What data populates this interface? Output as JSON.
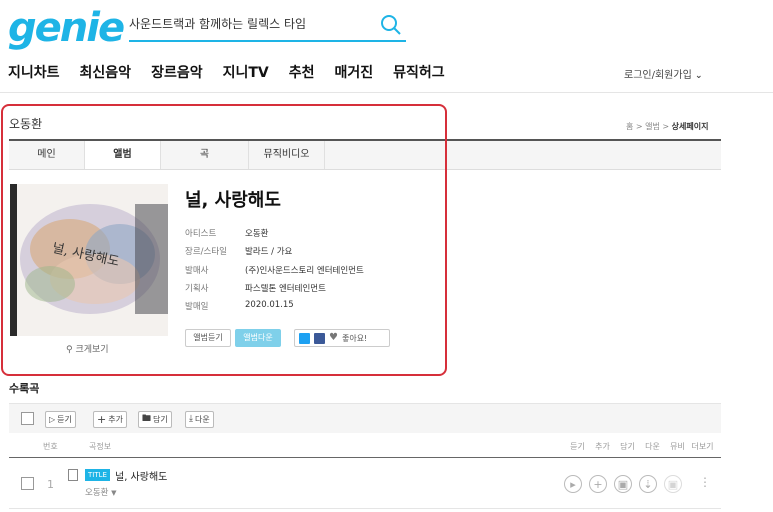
{
  "header": {
    "logo": "genie",
    "search_value": "사운드트랙과 함께하는 릴렉스 타임",
    "nav": [
      "지니차트",
      "최신음악",
      "장르음악",
      "지니TV",
      "추천",
      "매거진",
      "뮤직허그"
    ],
    "login": "로그인/회원가입"
  },
  "album": {
    "artist": "오동환",
    "breadcrumb_prefix": "홈 > 앨범 > ",
    "breadcrumb_current": "상세페이지",
    "tabs": [
      "메인",
      "앨범",
      "곡",
      "뮤직비디오"
    ],
    "title": "널, 사랑해도",
    "info": [
      {
        "label": "아티스트",
        "value": "오동환"
      },
      {
        "label": "장르/스타일",
        "value": "발라드 / 가요"
      },
      {
        "label": "발매사",
        "value": "(주)인사운드스토리 엔터테인먼트"
      },
      {
        "label": "기획사",
        "value": "파스텔톤 엔터테인먼트"
      },
      {
        "label": "발매일",
        "value": "2020.01.15"
      }
    ],
    "zoom_label": "크게보기",
    "btn_listen": "앨범듣기",
    "btn_download": "앨범다운",
    "like_label": "좋아요!",
    "cover_text": "널, 사랑해도"
  },
  "tracks": {
    "title": "수록곡",
    "toolbar": [
      "듣기",
      "추가",
      "담기",
      "다운"
    ],
    "columns": {
      "no": "번호",
      "info": "곡정보",
      "actions": [
        "듣기",
        "추가",
        "담기",
        "다운",
        "뮤비",
        "더보기"
      ]
    },
    "rows": [
      {
        "no": "1",
        "badge": "TITLE",
        "title": "널, 사랑해도",
        "artist": "오동환"
      }
    ]
  },
  "colors": {
    "accent": "#1eb4e6",
    "highlight": "#d62f3a"
  }
}
